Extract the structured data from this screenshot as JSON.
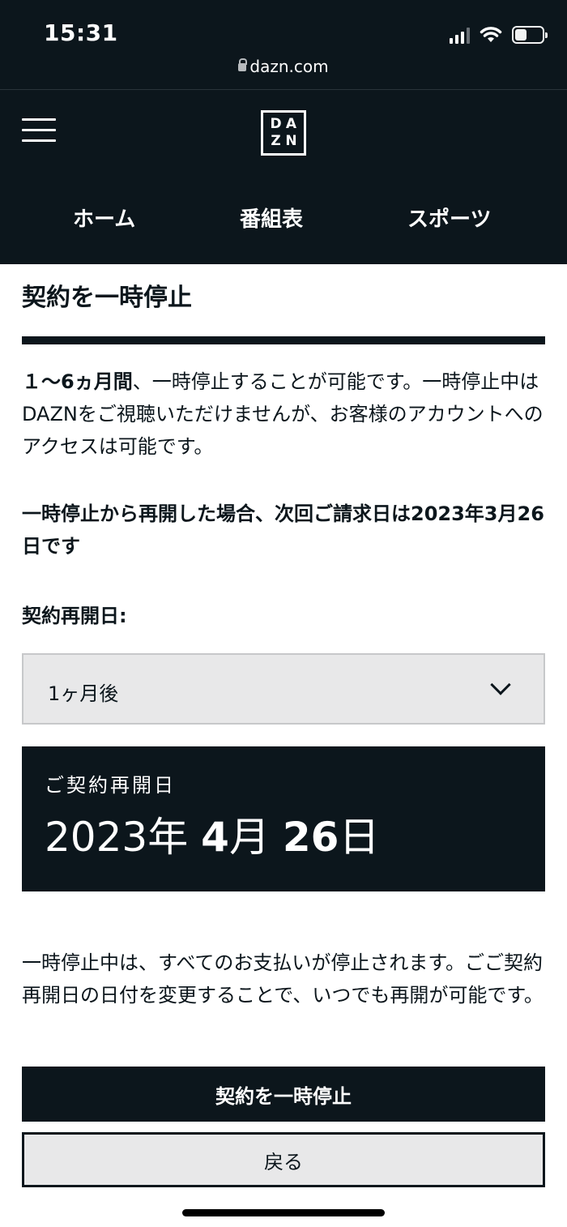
{
  "status_bar": {
    "time": "15:31"
  },
  "browser": {
    "url": "dazn.com"
  },
  "header": {
    "logo": [
      "D",
      "A",
      "Z",
      "N"
    ],
    "nav": [
      {
        "label": "ホーム"
      },
      {
        "label": "番組表"
      },
      {
        "label": "スポーツ"
      }
    ]
  },
  "page": {
    "title": "契約を一時停止",
    "intro_bold": "１〜6ヵ月間",
    "intro_rest": "、一時停止することが可能です。一時停止中はDAZNをご視聴いただけませんが、お客様のアカウントへのアクセスは可能です。",
    "billing_note": "一時停止から再開した場合、次回ご請求日は2023年3月26日です",
    "resume_label": "契約再開日:",
    "select": {
      "value": "1ヶ月後"
    },
    "resume_card": {
      "label": "ご契約再開日",
      "year": "2023",
      "year_unit": "年",
      "month": "4",
      "month_unit": "月",
      "day": "26",
      "day_unit": "日"
    },
    "footer_note": "一時停止中は、すべてのお支払いが停止されます。ごご契約再開日の日付を変更することで、いつでも再開が可能です。",
    "primary_button": "契約を一時停止",
    "secondary_button": "戻る"
  },
  "colors": {
    "dark": "#0c161c",
    "light_gray": "#e8e8e9",
    "white": "#ffffff"
  }
}
